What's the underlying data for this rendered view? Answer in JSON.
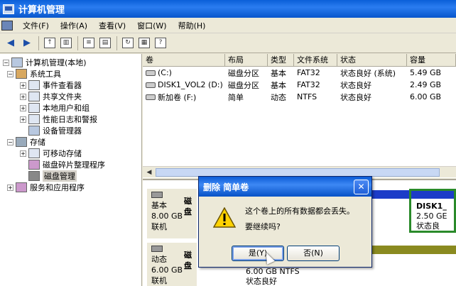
{
  "window": {
    "title": "计算机管理"
  },
  "menu": [
    "文件(F)",
    "操作(A)",
    "查看(V)",
    "窗口(W)",
    "帮助(H)"
  ],
  "tree": [
    {
      "label": "计算机管理(本地)",
      "level": 0,
      "expander": "-",
      "icon": "computer"
    },
    {
      "label": "系统工具",
      "level": 1,
      "expander": "-",
      "icon": "tools"
    },
    {
      "label": "事件查看器",
      "level": 2,
      "expander": "+",
      "icon": "event"
    },
    {
      "label": "共享文件夹",
      "level": 2,
      "expander": "+",
      "icon": "folder"
    },
    {
      "label": "本地用户和组",
      "level": 2,
      "expander": "+",
      "icon": "users"
    },
    {
      "label": "性能日志和警报",
      "level": 2,
      "expander": "+",
      "icon": "perf"
    },
    {
      "label": "设备管理器",
      "level": 2,
      "expander": "",
      "icon": "device"
    },
    {
      "label": "存储",
      "level": 1,
      "expander": "-",
      "icon": "storage"
    },
    {
      "label": "可移动存储",
      "level": 2,
      "expander": "+",
      "icon": "removable"
    },
    {
      "label": "磁盘碎片整理程序",
      "level": 2,
      "expander": "",
      "icon": "defrag"
    },
    {
      "label": "磁盘管理",
      "level": 2,
      "expander": "",
      "icon": "disk",
      "selected": true
    },
    {
      "label": "服务和应用程序",
      "level": 1,
      "expander": "+",
      "icon": "services"
    }
  ],
  "volume_list": {
    "columns": [
      "卷",
      "布局",
      "类型",
      "文件系统",
      "状态",
      "容量"
    ],
    "rows": [
      [
        "(C:)",
        "磁盘分区",
        "基本",
        "FAT32",
        "状态良好 (系统)",
        "5.49 GB"
      ],
      [
        "DISK1_VOL2 (D:)",
        "磁盘分区",
        "基本",
        "FAT32",
        "状态良好",
        "2.49 GB"
      ],
      [
        "新加卷 (F:)",
        "简单",
        "动态",
        "NTFS",
        "状态良好",
        "6.00 GB"
      ]
    ]
  },
  "disks": [
    {
      "name": "磁盘",
      "type": "基本",
      "size": "8.00 GB",
      "status": "联机"
    },
    {
      "name": "磁盘",
      "type": "动态",
      "size": "6.00 GB",
      "status": "联机"
    }
  ],
  "partitions": {
    "disk1_vol": {
      "name": "DISK1_",
      "size": "2.50 GE",
      "status": "状态良"
    },
    "new_vol": {
      "info": "6.00 GB NTFS",
      "status": "状态良好"
    }
  },
  "dialog": {
    "title": "删除 简单卷",
    "message1": "这个卷上的所有数据都会丢失。",
    "message2": "要继续吗?",
    "yes_label": "是(Y)",
    "no_label": "否(N)",
    "close_label": "✕"
  },
  "colors": {
    "titlebar": "#0a5fd8",
    "partition_blue": "#1c3cc8",
    "partition_olive": "#8a8a20",
    "selection_green": "#2a8a2a"
  }
}
